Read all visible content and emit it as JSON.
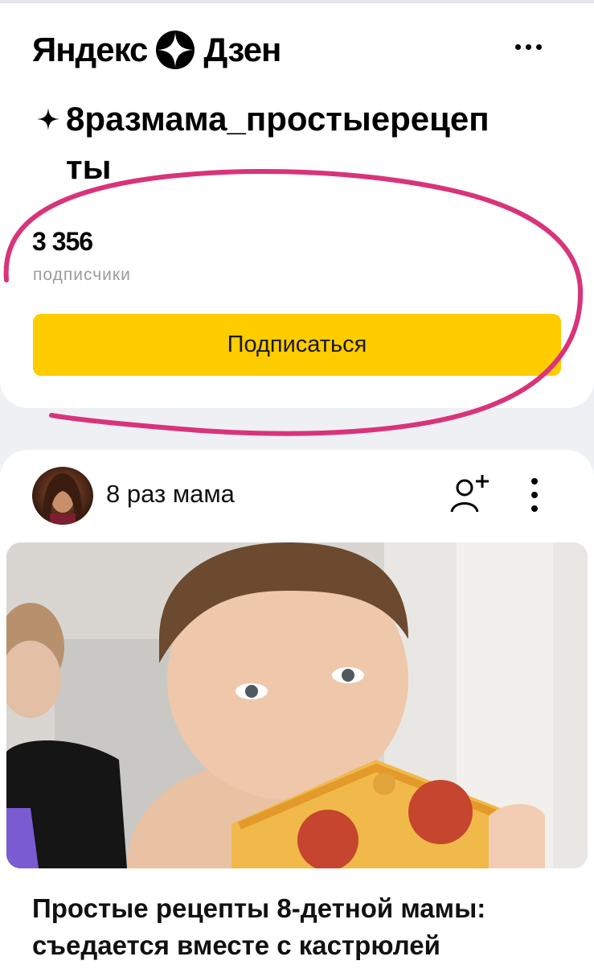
{
  "app": {
    "logo_left": "Яндекс",
    "logo_right": "Дзен",
    "menu_icon": "more-horizontal-icon"
  },
  "channel": {
    "title_line1": "8размама_простыерецеп",
    "title_line2": "ты",
    "subscribers_count": "3 356",
    "subscribers_label": "подписчики",
    "subscribe_label": "Подписаться"
  },
  "post": {
    "author_name": "8 раз мама",
    "title": "Простые рецепты 8-детной мамы: съедается вместе с кастрюлей",
    "image_description_icon": "photo-boy-eating-pizza"
  },
  "colors": {
    "accent_yellow": "#ffcc00",
    "annotation_pink": "#d9337a",
    "background": "#eef0f3",
    "muted_text": "#9a9ca0"
  }
}
